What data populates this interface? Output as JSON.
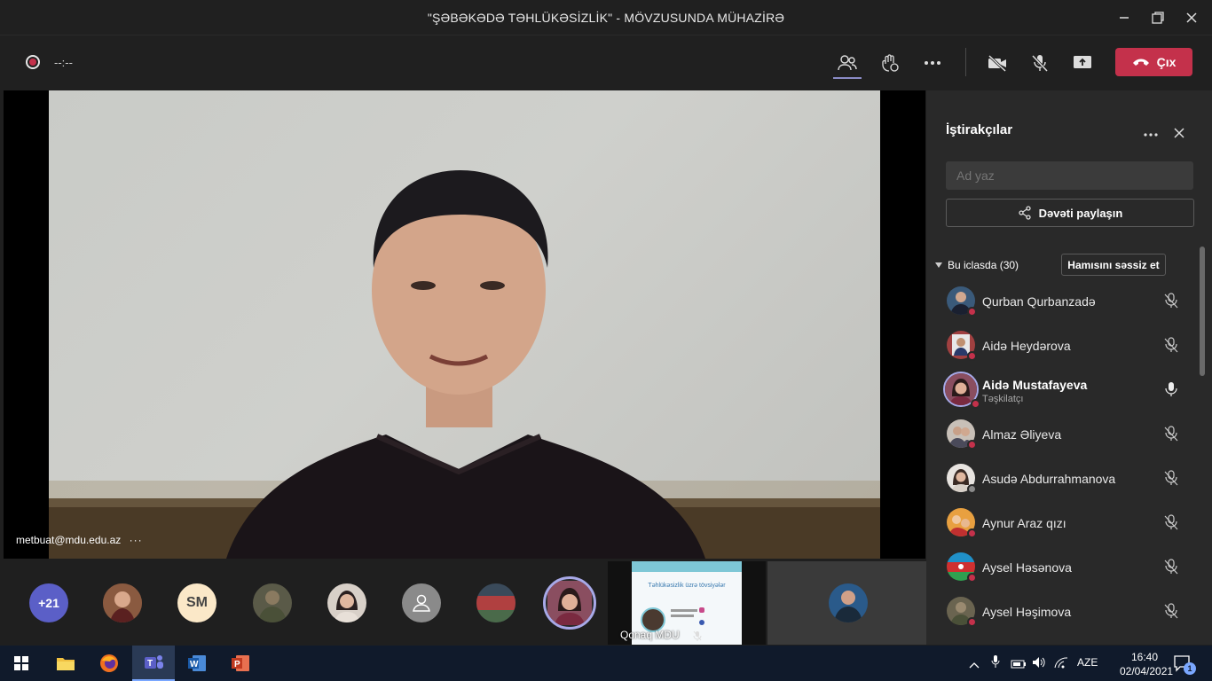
{
  "window": {
    "title": "\"ŞƏBƏKƏDƏ TƏHLÜKƏSİZLİK\" - MÖVZUSUNDA MÜHAZİRƏ"
  },
  "toolbar": {
    "timer": "--:--",
    "leave_label": "Çıx"
  },
  "stage": {
    "speaker_name": "metbuat@mdu.edu.az"
  },
  "strip": {
    "overflow_count": "+21",
    "initials": "SM",
    "share_tile_text": "Qonaq MDU",
    "share_tile_heading": "Təhlükəsizlik üzrə tövsiyələr"
  },
  "panel": {
    "title": "İştirakçılar",
    "search_placeholder": "Ad yaz",
    "invite_label": "Dəvəti paylaşın",
    "section_label": "Bu iclasda (30)",
    "mute_all_label": "Hamısını səssiz et",
    "participants": [
      {
        "name": "Qurban Qurbanzadə",
        "muted": true
      },
      {
        "name": "Aidə Heydərova",
        "muted": true
      },
      {
        "name": "Aidə Mustafayeva",
        "role": "Təşkilatçı",
        "muted": false
      },
      {
        "name": "Almaz Əliyeva",
        "muted": true
      },
      {
        "name": "Asudə Abdurrahmanova",
        "muted": true
      },
      {
        "name": "Aynur Araz qızı",
        "muted": true
      },
      {
        "name": "Aysel Həsənova",
        "muted": true
      },
      {
        "name": "Aysel Həşimova",
        "muted": true
      }
    ]
  },
  "taskbar": {
    "language": "AZE",
    "time": "16:40",
    "date": "02/04/2021",
    "notifications": "1"
  },
  "colors": {
    "leave": "#c4314b",
    "accent": "#8b8cc7",
    "status_red": "#c4314b"
  }
}
